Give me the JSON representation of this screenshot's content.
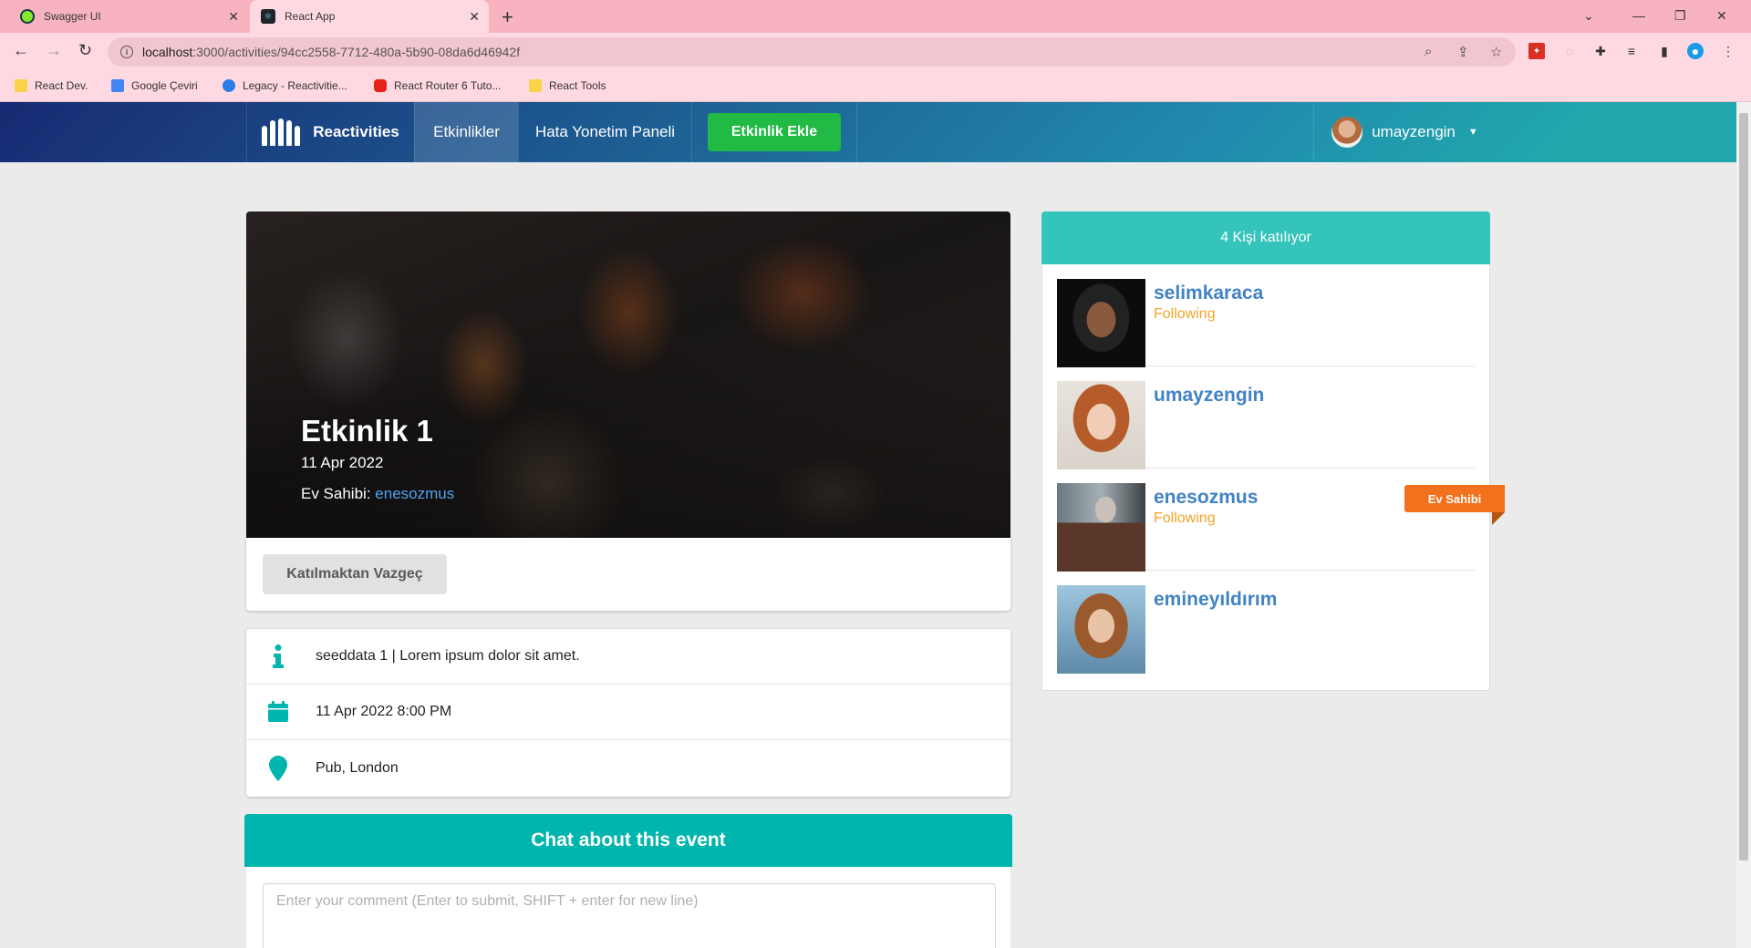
{
  "browser": {
    "tabs": [
      {
        "label": "Swagger UI"
      },
      {
        "label": "React App"
      }
    ],
    "url_host": "localhost",
    "url_rest": ":3000/activities/94cc2558-7712-480a-5b90-08da6d46942f",
    "bookmarks": [
      {
        "label": "React Dev.",
        "color": "#f9d34a"
      },
      {
        "label": "Google Çeviri",
        "color": "#4285f4"
      },
      {
        "label": "Legacy - Reactivitie...",
        "color": "#2b7de9"
      },
      {
        "label": "React Router 6 Tuto...",
        "color": "#e62117"
      },
      {
        "label": "React Tools",
        "color": "#f9d34a"
      }
    ]
  },
  "nav": {
    "brand": "Reactivities",
    "activities": "Etkinlikler",
    "errors": "Hata Yonetim Paneli",
    "add_activity": "Etkinlik Ekle",
    "username": "umayzengin"
  },
  "activity": {
    "title": "Etkinlik 1",
    "date": "11 Apr 2022",
    "host_label": "Ev Sahibi:",
    "host_name": "enesozmus",
    "cancel_button": "Katılmaktan Vazgeç",
    "description": "seeddata 1 | Lorem ipsum dolor sit amet.",
    "datetime": "11 Apr 2022 8:00 PM",
    "venue": "Pub, London"
  },
  "chat": {
    "title": "Chat about this event",
    "placeholder": "Enter your comment (Enter to submit, SHIFT + enter for new line)"
  },
  "attendees": {
    "title": "4 Kişi katılıyor",
    "host_ribbon": "Ev Sahibi",
    "list": [
      {
        "name": "selimkaraca",
        "status": "Following"
      },
      {
        "name": "umayzengin",
        "status": ""
      },
      {
        "name": "enesozmus",
        "status": "Following"
      },
      {
        "name": "emineyıldırım",
        "status": ""
      }
    ]
  },
  "colors": {
    "teal": "#00b5ad",
    "green": "#21ba45",
    "orange": "#f2711c",
    "link": "#4183c4",
    "following": "#f2a427"
  }
}
